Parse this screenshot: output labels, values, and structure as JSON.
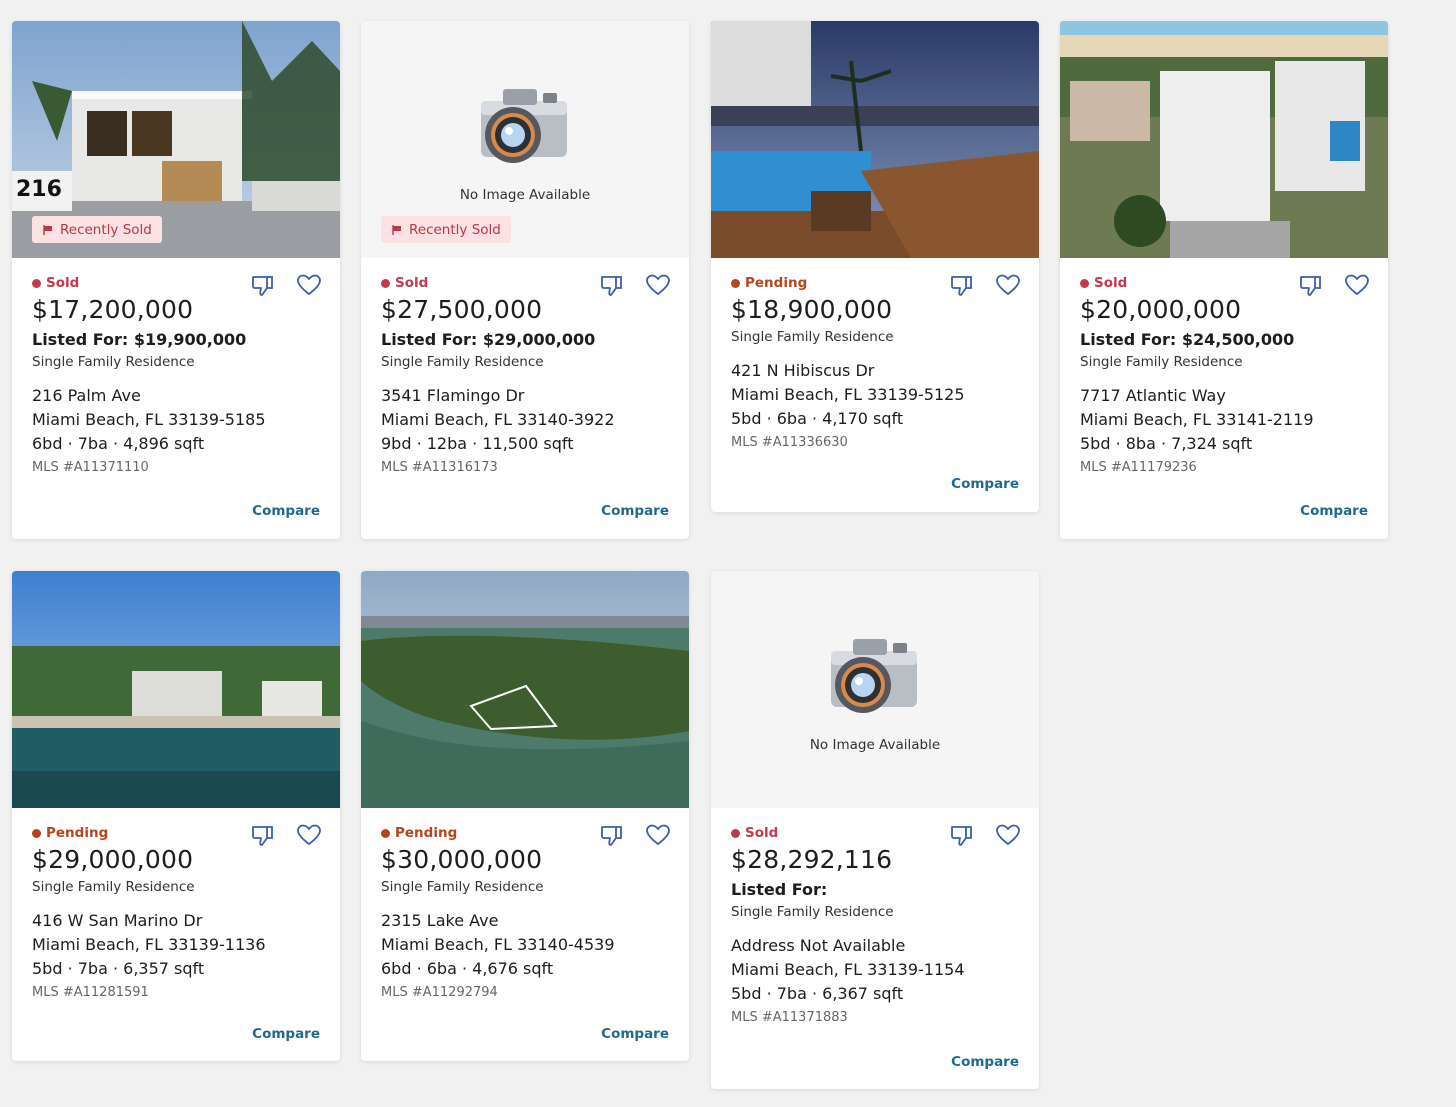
{
  "common": {
    "compare_label": "Compare",
    "no_image_text": "No Image Available",
    "badge_label": "Recently Sold",
    "listed_prefix": "Listed For:"
  },
  "colors": {
    "sold": "#c23b4d",
    "pending": "#b5461c",
    "compare": "#1f6a8c",
    "icon": "#3b5dad"
  },
  "listings": [
    {
      "photo": "modern-house-216",
      "house_number_overlay": "216",
      "badge": true,
      "status": "Sold",
      "price": "$17,200,000",
      "listed_for": "Listed For: $19,900,000",
      "type": "Single Family Residence",
      "street": "216 Palm Ave",
      "city": "Miami Beach, FL 33139-5185",
      "beds": "6bd · 7ba · 4,896 sqft",
      "mls": "MLS #A11371110"
    },
    {
      "photo": "none",
      "badge": true,
      "status": "Sold",
      "price": "$27,500,000",
      "listed_for": "Listed For: $29,000,000",
      "type": "Single Family Residence",
      "street": "3541 Flamingo Dr",
      "city": "Miami Beach, FL 33140-3922",
      "beds": "9bd · 12ba · 11,500 sqft",
      "mls": "MLS #A11316173"
    },
    {
      "photo": "pool-deck-night",
      "badge": false,
      "status": "Pending",
      "price": "$18,900,000",
      "type": "Single Family Residence",
      "street": "421 N Hibiscus Dr",
      "city": "Miami Beach, FL 33139-5125",
      "beds": "5bd · 6ba · 4,170 sqft",
      "mls": "MLS #A11336630"
    },
    {
      "photo": "aerial-beach-homes",
      "badge": false,
      "status": "Sold",
      "price": "$20,000,000",
      "listed_for": "Listed For: $24,500,000",
      "type": "Single Family Residence",
      "street": "7717 Atlantic Way",
      "city": "Miami Beach, FL 33141-2119",
      "beds": "5bd · 8ba · 7,324 sqft",
      "mls": "MLS #A11179236"
    },
    {
      "photo": "waterfront-house",
      "badge": false,
      "status": "Pending",
      "price": "$29,000,000",
      "type": "Single Family Residence",
      "street": "416 W San Marino Dr",
      "city": "Miami Beach, FL 33139-1136",
      "beds": "5bd · 7ba · 6,357 sqft",
      "mls": "MLS #A11281591"
    },
    {
      "photo": "aerial-island",
      "badge": false,
      "status": "Pending",
      "price": "$30,000,000",
      "type": "Single Family Residence",
      "street": "2315 Lake Ave",
      "city": "Miami Beach, FL 33140-4539",
      "beds": "6bd · 6ba · 4,676 sqft",
      "mls": "MLS #A11292794"
    },
    {
      "photo": "none",
      "badge": false,
      "status": "Sold",
      "price": "$28,292,116",
      "listed_for": "Listed For:",
      "type": "Single Family Residence",
      "street": "Address Not Available",
      "city": "Miami Beach, FL 33139-1154",
      "beds": "5bd · 7ba · 6,367 sqft",
      "mls": "MLS #A11371883"
    }
  ]
}
